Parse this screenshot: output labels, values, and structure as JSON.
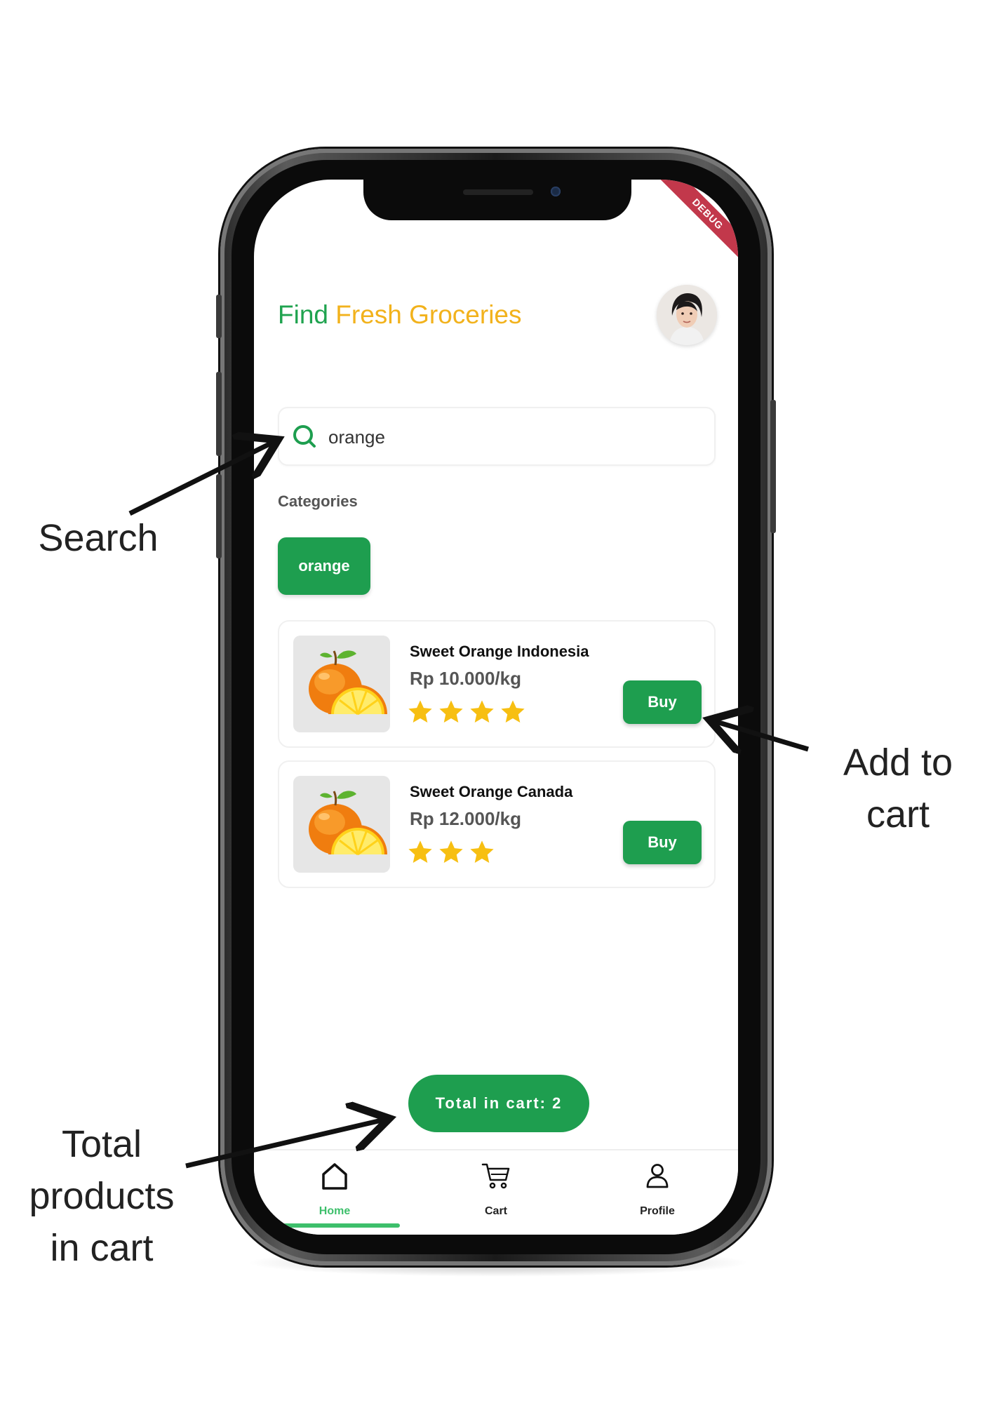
{
  "app": {
    "title_part1": "Find ",
    "title_part2": "Fresh Groceries",
    "debug_banner": "DEBUG"
  },
  "search": {
    "value": "orange"
  },
  "categories": {
    "label": "Categories",
    "chips": [
      {
        "label": "orange"
      }
    ]
  },
  "products": [
    {
      "name": "Sweet Orange Indonesia",
      "price": "Rp 10.000/kg",
      "rating": 4,
      "buy_label": "Buy"
    },
    {
      "name": "Sweet Orange Canada",
      "price": "Rp 12.000/kg",
      "rating": 3,
      "buy_label": "Buy"
    }
  ],
  "cart": {
    "total_label": "Total in cart: 2"
  },
  "bottom_nav": [
    {
      "label": "Home",
      "icon": "home-icon",
      "active": true
    },
    {
      "label": "Cart",
      "icon": "cart-icon",
      "active": false
    },
    {
      "label": "Profile",
      "icon": "profile-icon",
      "active": false
    }
  ],
  "annotations": {
    "search": "Search",
    "add_to_cart_line1": "Add to",
    "add_to_cart_line2": "cart",
    "total_line1": "Total",
    "total_line2": "products",
    "total_line3": "in cart"
  },
  "colors": {
    "primary_green": "#1e9e4f",
    "title_green": "#1fa34f",
    "accent_yellow": "#f2b21c",
    "star_yellow": "#f7bf12",
    "nav_active": "#3dbf6b"
  }
}
